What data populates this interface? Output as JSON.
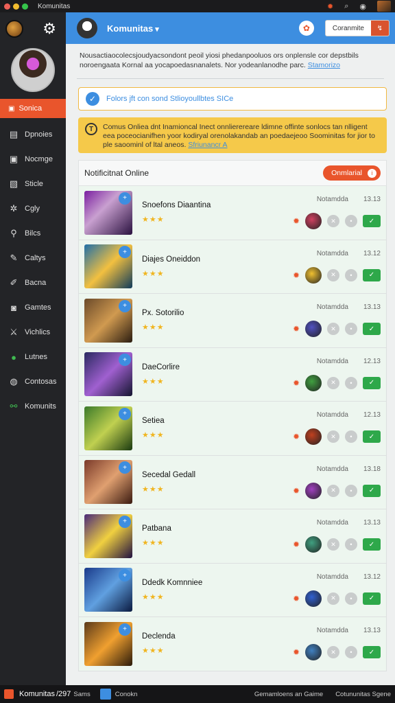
{
  "window": {
    "title": "Komunitas"
  },
  "sidebar": {
    "active_label": "Sonica",
    "items": [
      {
        "label": "Dpnoies",
        "icon": "document-icon"
      },
      {
        "label": "Nocmge",
        "icon": "image-icon"
      },
      {
        "label": "Sticle",
        "icon": "pages-icon"
      },
      {
        "label": "Cgly",
        "icon": "gear-icon"
      },
      {
        "label": "Bilcs",
        "icon": "pin-icon"
      },
      {
        "label": "Caltys",
        "icon": "wrench-icon"
      },
      {
        "label": "Bacna",
        "icon": "pencil-icon"
      },
      {
        "label": "Gamtes",
        "icon": "controller-icon"
      },
      {
        "label": "Vichlics",
        "icon": "sword-icon"
      },
      {
        "label": "Lutnes",
        "icon": "globe-icon"
      },
      {
        "label": "Contosas",
        "icon": "coin-icon"
      },
      {
        "label": "Komunits",
        "icon": "link-icon"
      }
    ]
  },
  "topbar": {
    "title": "Komunitas",
    "button_label": "Coranmite"
  },
  "notice": {
    "text": "Nousactiaocolecsjoudyacsondont peoil yiosi phedanpooluos ors onplensle cor depstbils noroengaata Kornal aa yocapoedasnanalets. Nor yodeanlanodhe parc.",
    "link": "Stamorizo"
  },
  "info_banner": {
    "text": "Folors jft con sond Stlioyoullbtes SICe"
  },
  "warning_banner": {
    "text": "Comus Onliea dnt Inamioncal Inect onnlierereare ldimne offinte sonlocs tan nlligent eea poceocianifhen yoor kodiryal orenolakandab an poedaejeoo Soominitas for jior to ple saoominl of ltal aneos.",
    "link": "Sfriunancr A"
  },
  "panel": {
    "title": "Notificitnat Online",
    "button_label": "Onmlarial"
  },
  "games": [
    {
      "name": "Snoefons Diaantina",
      "date": "Notamdda",
      "time": "13.13",
      "stars": "★★★"
    },
    {
      "name": "Diajes Oneiddon",
      "date": "Notamdda",
      "time": "13.12",
      "stars": "★★★"
    },
    {
      "name": "Px. Sotorilio",
      "date": "Notamdda",
      "time": "13.13",
      "stars": "★★★"
    },
    {
      "name": "DaeCorlire",
      "date": "Notamdda",
      "time": "12.13",
      "stars": "★★★"
    },
    {
      "name": "Setiea",
      "date": "Notamdda",
      "time": "12.13",
      "stars": "★★★"
    },
    {
      "name": "Secedal Gedall",
      "date": "Notamdda",
      "time": "13.18",
      "stars": "★★★"
    },
    {
      "name": "Patbana",
      "date": "Notamdda",
      "time": "13.13",
      "stars": "★★★"
    },
    {
      "name": "Ddedk Komnniee",
      "date": "Notamdda",
      "time": "13.12",
      "stars": "★★★"
    },
    {
      "name": "Declenda",
      "date": "Notamdda",
      "time": "13.13",
      "stars": "★★★"
    }
  ],
  "taskbar": {
    "app_label": "Komunitas",
    "app_count": "/297",
    "app_sub": "Sams",
    "item_label": "Conokn",
    "status_1": "Gemamloens an Gaime",
    "status_2": "Cotununitas Sgene"
  },
  "colors": {
    "accent_orange": "#e9552c",
    "topbar_blue": "#3d8ee0",
    "warning_yellow": "#f5c94a",
    "success_green": "#2ea84a",
    "sidebar_bg": "#232427"
  }
}
